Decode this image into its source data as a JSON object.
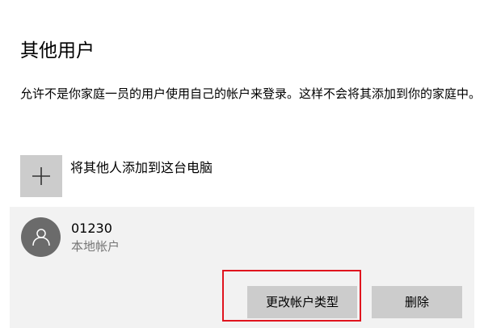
{
  "page": {
    "title": "其他用户",
    "description": "允许不是你家庭一员的用户使用自己的帐户来登录。这样不会将其添加到你的家庭中。"
  },
  "add_user": {
    "label": "将其他人添加到这台电脑",
    "icon": "plus-icon"
  },
  "user": {
    "name": "01230",
    "account_type": "本地帐户",
    "avatar_icon": "person-icon"
  },
  "actions": {
    "change_type_label": "更改帐户类型",
    "delete_label": "删除"
  },
  "colors": {
    "tile_gray": "#cccccc",
    "panel_bg": "#f2f2f2",
    "avatar_bg": "#6b6b6b",
    "secondary_text": "#767676",
    "highlight_border": "#e0141e"
  }
}
